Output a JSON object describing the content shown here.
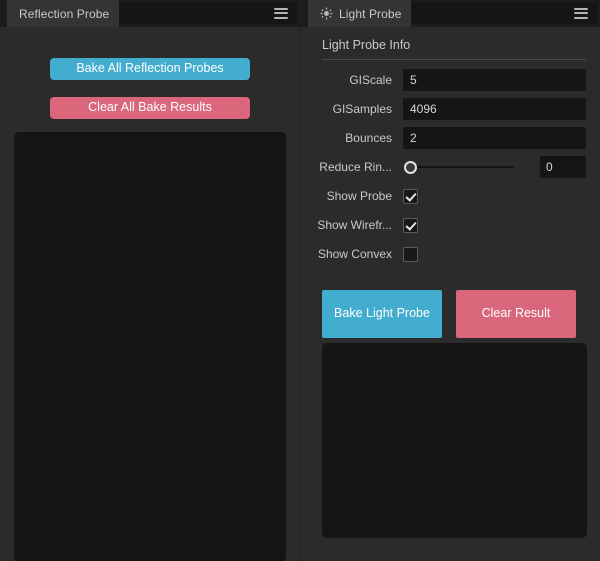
{
  "window": {
    "background": "#2b2b2b",
    "accent_blue": "#43adcf",
    "accent_pink": "#d9667b"
  },
  "left_panel": {
    "tab": {
      "label": "Reflection Probe",
      "menu_icon": "hamburger-icon"
    },
    "buttons": [
      {
        "label": "Bake All Reflection Probes",
        "style": "bake"
      },
      {
        "label": "Clear All Bake Results",
        "style": "clear"
      }
    ],
    "preview_area": {
      "label": ""
    }
  },
  "right_panel": {
    "tab": {
      "label": "Light Probe",
      "icon": "sun-icon",
      "menu_icon": "hamburger-icon"
    },
    "section_title": "Light Probe Info",
    "fields": [
      {
        "label": "GIScale",
        "value": "5",
        "name": "giscale"
      },
      {
        "label": "GISamples",
        "value": "4096",
        "name": "gisamples"
      },
      {
        "label": "Bounces",
        "value": "2",
        "name": "bounces"
      }
    ],
    "slider": {
      "label": "Reduce Rin...",
      "value": "0",
      "position_percent": 0
    },
    "checkboxes": [
      {
        "label": "Show Probe",
        "checked": true,
        "name": "show-probe"
      },
      {
        "label": "Show Wirefr...",
        "checked": true,
        "name": "show-wireframe"
      },
      {
        "label": "Show Convex",
        "checked": false,
        "name": "show-convex"
      }
    ],
    "buttons": [
      {
        "label": "Bake Light Probe",
        "style": "bake"
      },
      {
        "label": "Clear Result",
        "style": "clear"
      }
    ],
    "preview_area": {
      "label": ""
    }
  }
}
